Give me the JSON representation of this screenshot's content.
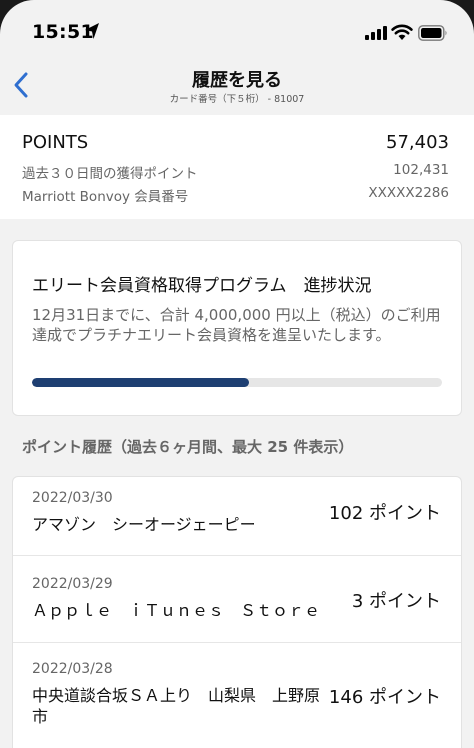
{
  "status_bar": {
    "time": "15:51"
  },
  "nav": {
    "title": "履歴を見る",
    "subtitle": "カード番号（下５桁） - 81007"
  },
  "points_card": {
    "label": "POINTS",
    "value": "57,403",
    "rows": [
      {
        "label": "過去３０日間の獲得ポイント",
        "value": "102,431"
      },
      {
        "label": "Marriott Bonvoy 会員番号",
        "value": "XXXXX2286"
      }
    ]
  },
  "elite_program": {
    "title": "エリート会員資格取得プログラム　進捗状況",
    "description": "12月31日までに、合計 4,000,000 円以上（税込）のご利用達成でプラチナエリート会員資格を進呈いたします。",
    "progress_fraction": 0.53
  },
  "history": {
    "header": "ポイント履歴（過去６ヶ月間、最大 25 件表示）",
    "items": [
      {
        "date": "2022/03/30",
        "description": "アマゾン　シーオージェーピー",
        "points": "102 ポイント"
      },
      {
        "date": "2022/03/29",
        "description": "Ａｐｐｌｅ　ｉＴｕｎｅｓ　Ｓｔｏｒｅ",
        "points": "3 ポイント"
      },
      {
        "date": "2022/03/28",
        "description": "中央道談合坂ＳＡ上り　山梨県　上野原市",
        "points": "146 ポイント"
      }
    ]
  },
  "icons": {
    "location": "location-arrow-icon",
    "signal": "cellular-signal-icon",
    "wifi": "wifi-icon",
    "battery": "battery-icon",
    "back": "chevron-left-icon"
  },
  "colors": {
    "accent": "#1e3f72",
    "back_chevron": "#2f6fd0",
    "background": "#f2f2f2"
  }
}
